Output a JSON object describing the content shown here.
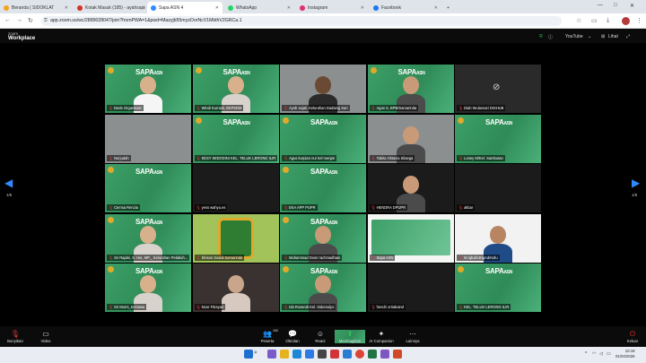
{
  "browser": {
    "tabs": [
      {
        "title": "Beranda | SIDOKLAT",
        "color": "#f4a41c"
      },
      {
        "title": "Kotak Masuk (185) - ayahsapir@...",
        "color": "#d93025"
      },
      {
        "title": "Sapa ASN 4",
        "color": "#2d8cff"
      },
      {
        "title": "WhatsApp",
        "color": "#25d366"
      },
      {
        "title": "Instagram",
        "color": "#e1306c"
      },
      {
        "title": "Facebook",
        "color": "#1877f2"
      }
    ],
    "new_tab": "+",
    "url": "app.zoom.us/wc/2889028047/join?fromPWA=1&pwd=Mazyjb55myzOorNcV1MkthV2GRCa.1",
    "window_controls": {
      "min": "—",
      "max": "□",
      "close": "✕"
    }
  },
  "zoom": {
    "brand_top": "zoom",
    "brand_bottom": "Workplace",
    "youtube_label": "YouTube",
    "view_label": "Lihat",
    "page_left": "1/6",
    "page_right": "1/6"
  },
  "participants": [
    {
      "name": "Dede Organisasi",
      "kind": "person-green"
    },
    {
      "name": "Windi Kurniati, BKPSDM",
      "kind": "person-green"
    },
    {
      "name": "Ayob sajali, Kelurahan Dadaing Sari",
      "kind": "person-gray"
    },
    {
      "name": "Agus S, BPB/Samarinda",
      "kind": "avatar-green"
    },
    {
      "name": "Diah Wulansari DISHUB",
      "kind": "cam-off"
    },
    {
      "name": "Norjudah",
      "kind": "gray"
    },
    {
      "name": "KESY WIDODINI KEL. TELUK LERONG ILIR",
      "kind": "green"
    },
    {
      "name": "Agus kurpian nur kel menjat",
      "kind": "green"
    },
    {
      "name": "Tabita Oktavia Silaega",
      "kind": "avatar-gray"
    },
    {
      "name": "Loney M/Kel. Sambutan",
      "kind": "green"
    },
    {
      "name": "Cemsa Renzia",
      "kind": "green"
    },
    {
      "name": "yess wahyu.es",
      "kind": "black"
    },
    {
      "name": "EKA APP PUPR",
      "kind": "green"
    },
    {
      "name": "HENDRA DPUPR",
      "kind": "avatar-black"
    },
    {
      "name": "akbar",
      "kind": "black"
    },
    {
      "name": "Sri Rajabi, S. Hut, MP._ Kelurahan Pelabuh...",
      "kind": "person-green"
    },
    {
      "name": "Dinsos Sosial Samarinda",
      "kind": "emblem"
    },
    {
      "name": "Muhammad Dosri rachmadhani",
      "kind": "avatar-green"
    },
    {
      "name": "Sapa ASN",
      "kind": "slide"
    },
    {
      "name": "M.Iqbal/LBIgAdmUlu",
      "kind": "person-white"
    },
    {
      "name": "Sri Murni_KelJawa",
      "kind": "person-green"
    },
    {
      "name": "Noor Fitrayan",
      "kind": "person-dark"
    },
    {
      "name": "Ida Rosandi Kel. Sidomulyo",
      "kind": "avatar-green"
    },
    {
      "name": "hendri ortiabaind",
      "kind": "black"
    },
    {
      "name": "KEL. TELUK LERONG ILIR",
      "kind": "green"
    }
  ],
  "sapa_logo": {
    "big": "SAPA",
    "small": "ASN"
  },
  "toolbar": {
    "audio": "Bunyikan",
    "video": "Video",
    "participants": "Peserta",
    "participants_count": "456",
    "chat": "Obrolan",
    "react": "React",
    "share": "Membagikan",
    "companion": "AI Companion",
    "more": "Lainnya",
    "leave": "Keluar"
  },
  "clock": {
    "time": "10:18",
    "date": "01/04/2026"
  },
  "colors": {
    "zoom_blue": "#2e8bff",
    "mute_red": "#e53935",
    "sapa_green": "#3d9f67"
  }
}
